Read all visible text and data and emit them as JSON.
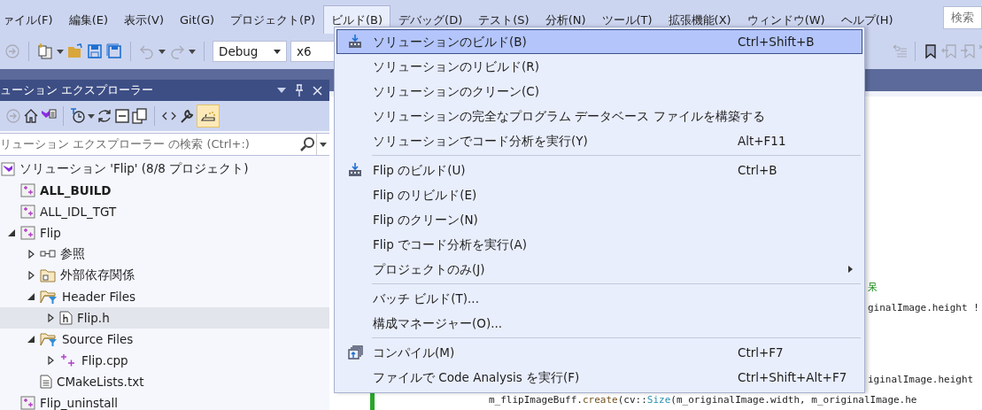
{
  "menubar": {
    "items": [
      {
        "label": "ァイル(F)",
        "open": false
      },
      {
        "label": "編集(E)",
        "open": false
      },
      {
        "label": "表示(V)",
        "open": false
      },
      {
        "label": "Git(G)",
        "open": false
      },
      {
        "label": "プロジェクト(P)",
        "open": false
      },
      {
        "label": "ビルド(B)",
        "open": true
      },
      {
        "label": "デバッグ(D)",
        "open": false
      },
      {
        "label": "テスト(S)",
        "open": false
      },
      {
        "label": "分析(N)",
        "open": false
      },
      {
        "label": "ツール(T)",
        "open": false
      },
      {
        "label": "拡張機能(X)",
        "open": false
      },
      {
        "label": "ウィンドウ(W)",
        "open": false
      },
      {
        "label": "ヘルプ(H)",
        "open": false
      }
    ],
    "search": {
      "placeholder": "検索"
    }
  },
  "toolbar": {
    "configuration": "Debug",
    "platform": "x6"
  },
  "solution_explorer": {
    "title": "ューション エクスプローラー",
    "search": {
      "placeholder": "リューション エクスプローラー の検索 (Ctrl+:)"
    },
    "tree": [
      {
        "label": "ソリューション 'Flip' (8/8 プロジェクト)",
        "kind": "solution",
        "bold": false,
        "selected": false,
        "children": [
          {
            "label": "ALL_BUILD",
            "kind": "project",
            "bold": true,
            "selected": false
          },
          {
            "label": "ALL_IDL_TGT",
            "kind": "project",
            "bold": false,
            "selected": false
          },
          {
            "label": "Flip",
            "kind": "project",
            "bold": false,
            "selected": false,
            "expanded": true,
            "children": [
              {
                "label": "参照",
                "kind": "references",
                "bold": false,
                "selected": false,
                "expanded": false
              },
              {
                "label": "外部依存関係",
                "kind": "external",
                "bold": false,
                "selected": false,
                "expanded": false
              },
              {
                "label": "Header Files",
                "kind": "filter",
                "bold": false,
                "selected": false,
                "expanded": true,
                "children": [
                  {
                    "label": "Flip.h",
                    "kind": "header",
                    "bold": false,
                    "selected": true,
                    "expanded": false
                  }
                ]
              },
              {
                "label": "Source Files",
                "kind": "filter",
                "bold": false,
                "selected": false,
                "expanded": true,
                "children": [
                  {
                    "label": "Flip.cpp",
                    "kind": "cpp",
                    "bold": false,
                    "selected": false,
                    "expanded": false
                  }
                ]
              },
              {
                "label": "CMakeLists.txt",
                "kind": "text",
                "bold": false,
                "selected": false
              }
            ]
          },
          {
            "label": "Flip_uninstall",
            "kind": "project",
            "bold": false,
            "selected": false
          }
        ]
      }
    ]
  },
  "editor": {
    "blocks": [
      [
        {
          "kind": "partial",
          "tokens": [
            {
              "kind": "comment",
              "text": "呆"
            }
          ]
        },
        {
          "kind": "partial",
          "tokens": [
            {
              "kind": "plain",
              "text": "ginalImage.height !"
            }
          ]
        }
      ],
      [
        {
          "kind": "partial",
          "tokens": [
            {
              "kind": "plain",
              "text": "iginalImage.height"
            }
          ]
        },
        {
          "kind": "full",
          "tokens": [
            {
              "kind": "plain",
              "text": "m_flipImageBuff."
            },
            {
              "kind": "func",
              "text": "create"
            },
            {
              "kind": "plain",
              "text": "(cv::"
            },
            {
              "kind": "type",
              "text": "Size"
            },
            {
              "kind": "plain",
              "text": "(m_originalImage.width, m_originalImage.he"
            }
          ]
        }
      ]
    ]
  },
  "build_menu": {
    "items": [
      {
        "kind": "build",
        "label": "ソリューションのビルド(B)",
        "shortcut": "Ctrl+Shift+B",
        "selected": true
      },
      {
        "kind": "item",
        "label": "ソリューションのリビルド(R)",
        "selected": false
      },
      {
        "kind": "item",
        "label": "ソリューションのクリーン(C)",
        "selected": false
      },
      {
        "kind": "item",
        "label": "ソリューションの完全なプログラム データベース ファイルを構築する",
        "selected": false
      },
      {
        "kind": "item",
        "label": "ソリューションでコード分析を実行(Y)",
        "shortcut": "Alt+F11",
        "selected": false
      },
      {
        "kind": "separator"
      },
      {
        "kind": "build",
        "label": "Flip のビルド(U)",
        "shortcut": "Ctrl+B",
        "selected": false
      },
      {
        "kind": "item",
        "label": "Flip のリビルド(E)",
        "selected": false
      },
      {
        "kind": "item",
        "label": "Flip のクリーン(N)",
        "selected": false
      },
      {
        "kind": "item",
        "label": "Flip でコード分析を実行(A)",
        "selected": false
      },
      {
        "kind": "item",
        "label": "プロジェクトのみ(J)",
        "submenu": true,
        "selected": false
      },
      {
        "kind": "separator"
      },
      {
        "kind": "item",
        "label": "バッチ ビルド(T)...",
        "selected": false
      },
      {
        "kind": "item",
        "label": "構成マネージャー(O)...",
        "selected": false
      },
      {
        "kind": "separator"
      },
      {
        "kind": "compile",
        "label": "コンパイル(M)",
        "shortcut": "Ctrl+F7",
        "selected": false
      },
      {
        "kind": "item",
        "label": "ファイルで Code Analysis を実行(F)",
        "shortcut": "Ctrl+Shift+Alt+F7",
        "selected": false
      }
    ]
  }
}
